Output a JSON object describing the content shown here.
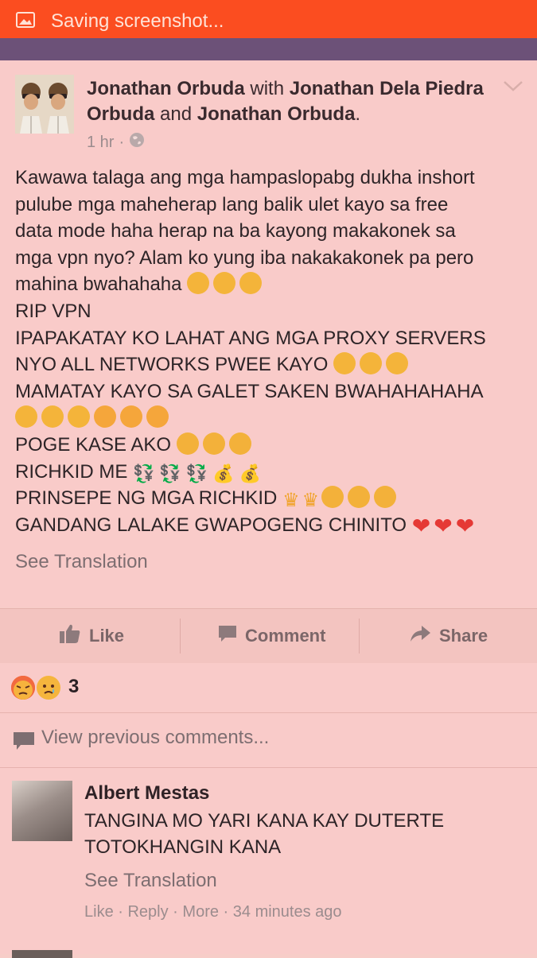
{
  "status_bar": {
    "text": "Saving screenshot...",
    "icon": "image-icon",
    "color": "#fb4d20"
  },
  "post": {
    "author": "Jonathan Orbuda",
    "with_word": "with",
    "tagged_1": "Jonathan Dela Piedra Orbuda",
    "and_word": "and",
    "tagged_2": "Jonathan Orbuda",
    "period": ".",
    "time": "1 hr",
    "separator": "·",
    "privacy_icon": "globe-icon",
    "body": {
      "line1": "Kawawa talaga ang mga hampaslopabg dukha inshort",
      "line2": "pulube mga maheherap lang balik ulet kayo sa free",
      "line3": "data mode haha herap na ba kayong makakonek sa",
      "line4": "mga vpn nyo? Alam ko yung iba nakakakonek pa pero",
      "line5": "mahina bwahahaha",
      "line6": "RIP VPN",
      "line7": "IPAPAKATAY KO LAHAT ANG MGA PROXY SERVERS",
      "line8": "NYO ALL NETWORKS PWEE KAYO",
      "line9": "MAMATAY KAYO SA GALET SAKEN BWAHAHAHAHA",
      "line11": "POGE KASE AKO",
      "line12": "RICHKID ME",
      "line13": "PRINSEPE NG MGA RICHKID",
      "line14": "GANDANG LALAKE GWAPOGENG CHINITO"
    },
    "emoji": {
      "money_glyph": "💱",
      "moneybag_glyph": "💰",
      "crown_glyph": "♛",
      "heart_glyph": "❤"
    },
    "see_translation": "See Translation"
  },
  "actions": {
    "like": "Like",
    "comment": "Comment",
    "share": "Share"
  },
  "reactions": {
    "count": "3",
    "icons": [
      "angry-face-icon",
      "sad-face-icon"
    ]
  },
  "view_previous": "View previous comments...",
  "comment": {
    "name": "Albert Mestas",
    "text_line1": "TANGINA MO YARI KANA KAY DUTERTE",
    "text_line2": "TOTOKHANGIN KANA",
    "see_translation": "See Translation",
    "like": "Like",
    "reply": "Reply",
    "more": "More",
    "time": "34 minutes ago",
    "dot": " · "
  }
}
